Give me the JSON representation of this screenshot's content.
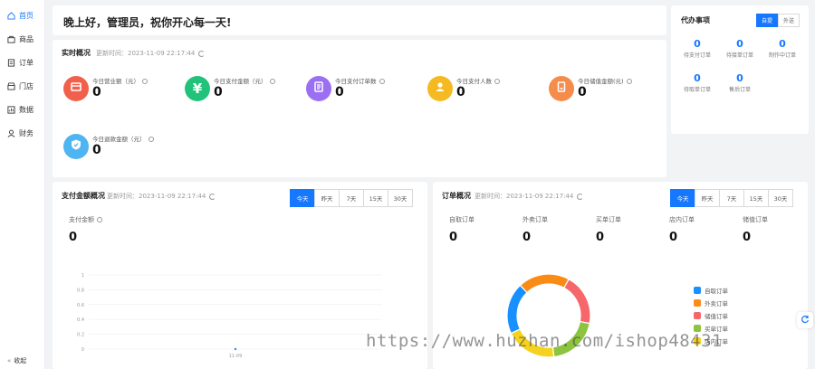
{
  "sidebar": {
    "items": [
      {
        "label": "首页",
        "icon": "home-icon",
        "active": true
      },
      {
        "label": "商品",
        "icon": "goods-icon",
        "active": false
      },
      {
        "label": "订单",
        "icon": "order-icon",
        "active": false
      },
      {
        "label": "门店",
        "icon": "store-icon",
        "active": false
      },
      {
        "label": "数据",
        "icon": "data-icon",
        "active": false
      },
      {
        "label": "财务",
        "icon": "finance-icon",
        "active": false
      }
    ],
    "collapse_label": "收起"
  },
  "greeting": "晚上好，管理员，祝你开心每一天!",
  "realtime": {
    "title": "实时概况",
    "time": "更新时间：2023-11-09 22:17:44",
    "stats": [
      {
        "label": "今日营业额（元）",
        "value": "0",
        "color": "#f2604b",
        "icon": "wallet-icon"
      },
      {
        "label": "今日支付金额（元）",
        "value": "0",
        "color": "#21c27a",
        "icon": "yen-icon"
      },
      {
        "label": "今日支付订单数",
        "value": "0",
        "color": "#9b6ff2",
        "icon": "list-icon"
      },
      {
        "label": "今日支付人数",
        "value": "0",
        "color": "#f5b921",
        "icon": "user-icon"
      },
      {
        "label": "今日储值金额(元)",
        "value": "0",
        "color": "#f58c4b",
        "icon": "card-icon"
      },
      {
        "label": "今日退款金额（元）",
        "value": "0",
        "color": "#4fb4f2",
        "icon": "shield-icon"
      }
    ]
  },
  "todo": {
    "title": "代办事项",
    "toggle": [
      "自提",
      "外送"
    ],
    "items": [
      {
        "count": "0",
        "label": "待支付订单"
      },
      {
        "count": "0",
        "label": "待接单订单"
      },
      {
        "count": "0",
        "label": "制作中订单"
      },
      {
        "count": "0",
        "label": "待取单订单"
      },
      {
        "count": "0",
        "label": "售后订单"
      }
    ]
  },
  "pay": {
    "title": "支付金额概况",
    "time": "更新时间：2023-11-09 22:17:44",
    "tabs": [
      "今天",
      "昨天",
      "7天",
      "15天",
      "30天"
    ],
    "metric_label": "支付金额",
    "metric_value": "0"
  },
  "order": {
    "title": "订单概况",
    "time": "更新时间：2023-11-09 22:17:44",
    "tabs": [
      "今天",
      "昨天",
      "7天",
      "15天",
      "30天"
    ],
    "metrics": [
      {
        "label": "自取订单",
        "value": "0"
      },
      {
        "label": "外卖订单",
        "value": "0"
      },
      {
        "label": "买单订单",
        "value": "0"
      },
      {
        "label": "店内订单",
        "value": "0"
      },
      {
        "label": "储值订单",
        "value": "0"
      }
    ]
  },
  "chart_data": [
    {
      "type": "line",
      "x": [
        "11-09"
      ],
      "series": [
        {
          "values": [
            0
          ]
        }
      ],
      "yticks": [
        "0",
        "0.2",
        "0.4",
        "0.6",
        "0.8",
        "1"
      ],
      "ylim": [
        0,
        1
      ],
      "grid": true
    },
    {
      "type": "pie",
      "categories": [
        "自取订单",
        "外卖订单",
        "储值订单",
        "买单订单",
        "店内订单"
      ],
      "colors": [
        "#1890ff",
        "#fa8c16",
        "#f5676b",
        "#8cc43f",
        "#f5d21f"
      ],
      "values": [
        20,
        20,
        20,
        20,
        20
      ],
      "legend": "right"
    }
  ],
  "watermark": "https://www.huzhan.com/ishop48431"
}
